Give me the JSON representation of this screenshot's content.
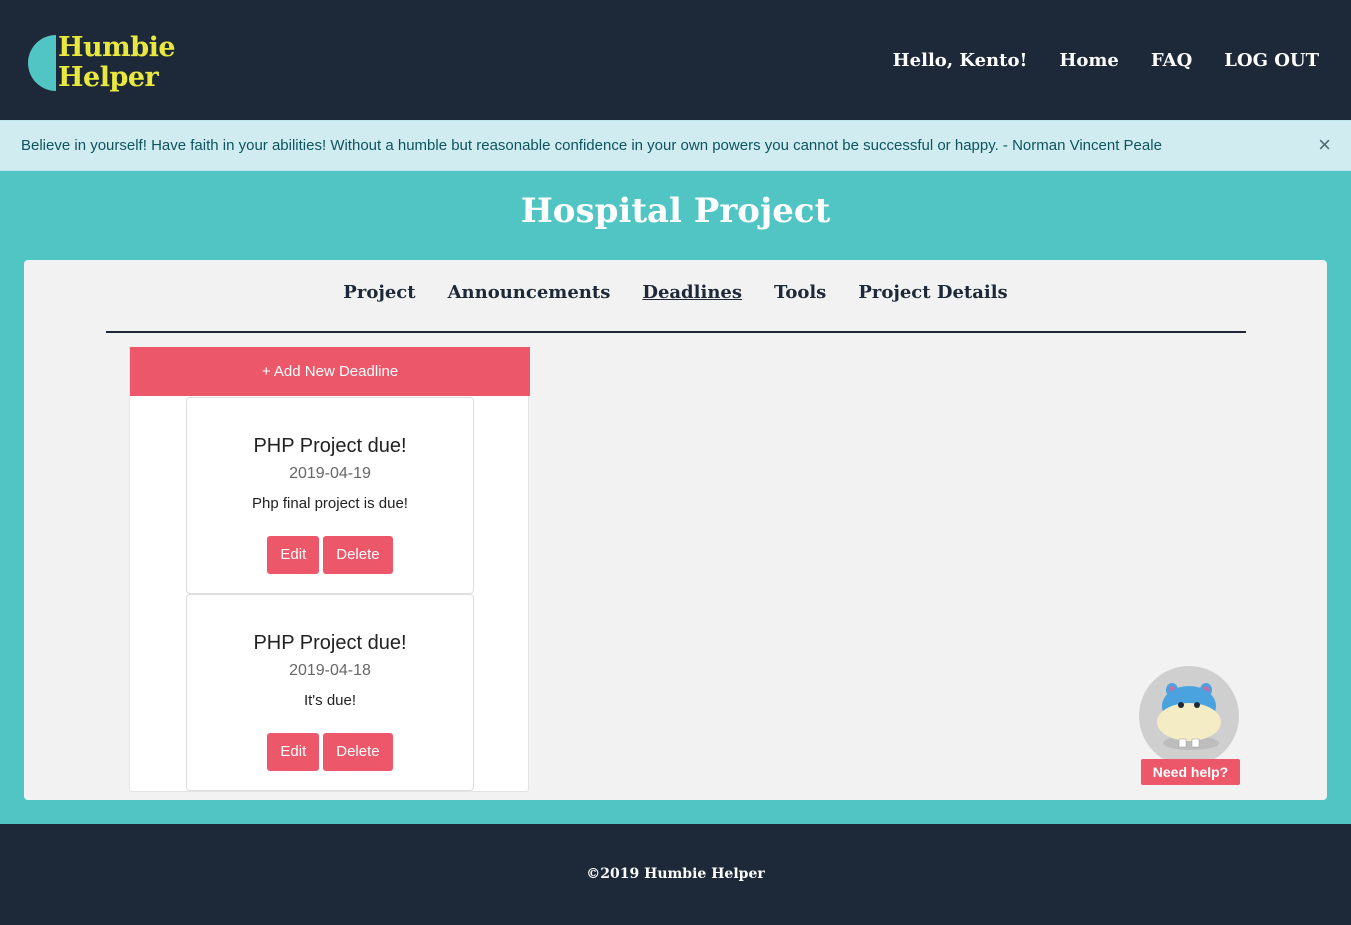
{
  "brand": {
    "line1": "Humbie",
    "line2": "Helper",
    "accent_color": "#e8e83f",
    "mark_color": "#50c5c3"
  },
  "nav": {
    "greeting": "Hello, Kento!",
    "home": "Home",
    "faq": "FAQ",
    "logout": "LOG OUT"
  },
  "alert": {
    "text": "Believe in yourself! Have faith in your abilities! Without a humble but reasonable confidence in your own powers you cannot be successful or happy. - Norman Vincent Peale",
    "close": "×"
  },
  "page": {
    "title": "Hospital Project"
  },
  "tabs": [
    {
      "label": "Project"
    },
    {
      "label": "Announcements"
    },
    {
      "label": "Deadlines",
      "active": true
    },
    {
      "label": "Tools"
    },
    {
      "label": "Project Details"
    }
  ],
  "deadlines": {
    "add_label": "+ Add New Deadline",
    "items": [
      {
        "title": "PHP Project due!",
        "date": "2019-04-19",
        "description": "Php final project is due!",
        "edit": "Edit",
        "delete": "Delete"
      },
      {
        "title": "PHP Project due!",
        "date": "2019-04-18",
        "description": "It's due!",
        "edit": "Edit",
        "delete": "Delete"
      }
    ]
  },
  "helper": {
    "label": "Need help?",
    "icon": "hippo-icon"
  },
  "footer": {
    "text": "©2019 Humbie Helper"
  },
  "colors": {
    "navy": "#1d2938",
    "teal": "#50c5c3",
    "coral": "#ec5769",
    "panel": "#f2f2f2"
  }
}
